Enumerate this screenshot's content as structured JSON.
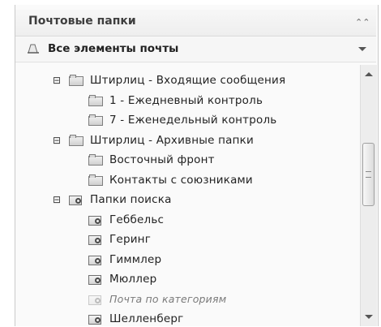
{
  "header": {
    "title": "Почтовые папки",
    "collapse_icon": "double-chevron-up-icon",
    "collapse_glyph": "⌃⌃"
  },
  "all_items": {
    "label": "Все элементы почты",
    "icon": "mail-items-icon"
  },
  "tree": {
    "expander_glyph": "⊟",
    "items": [
      {
        "label": "Штирлиц -  Входящие сообщения",
        "kind": "folder",
        "level": 0,
        "expanded": true
      },
      {
        "label": "1 - Ежедневный контроль",
        "kind": "folder",
        "level": 1
      },
      {
        "label": "7 - Еженедельный контроль",
        "kind": "folder",
        "level": 1
      },
      {
        "label": "Штирлиц - Архивные папки",
        "kind": "folder",
        "level": 0,
        "expanded": true
      },
      {
        "label": "Восточный фронт",
        "kind": "folder",
        "level": 1
      },
      {
        "label": "Контакты с союзниками",
        "kind": "folder",
        "level": 1
      },
      {
        "label": "Папки поиска",
        "kind": "search-folder",
        "level": 0,
        "expanded": true
      },
      {
        "label": "Геббельс",
        "kind": "search-folder",
        "level": 1
      },
      {
        "label": "Геринг",
        "kind": "search-folder",
        "level": 1
      },
      {
        "label": "Гиммлер",
        "kind": "search-folder",
        "level": 1
      },
      {
        "label": "Мюллер",
        "kind": "search-folder",
        "level": 1
      },
      {
        "label": "Почта по категориям",
        "kind": "search-folder",
        "level": 1,
        "dim": true
      },
      {
        "label": "Шелленберг",
        "kind": "search-folder",
        "level": 1
      }
    ]
  }
}
